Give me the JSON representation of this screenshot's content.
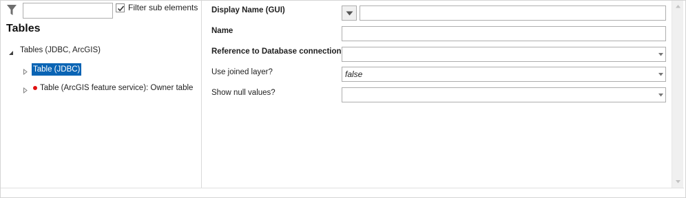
{
  "filter": {
    "input_value": "",
    "checkbox_checked": true,
    "checkbox_label": "Filter sub elements",
    "icon": "filter-funnel-icon"
  },
  "tree": {
    "heading": "Tables",
    "root": {
      "label": "Tables (JDBC, ArcGIS)",
      "expanded": true,
      "children": [
        {
          "label": "Table (JDBC)",
          "selected": true,
          "error": false
        },
        {
          "label": "Table (ArcGIS feature service): Owner table",
          "selected": false,
          "error": true
        }
      ]
    }
  },
  "form": {
    "display_name": {
      "label": "Display Name (GUI)",
      "value": ""
    },
    "name": {
      "label": "Name",
      "value": ""
    },
    "db_connection": {
      "label": "Reference to Database connection",
      "value": ""
    },
    "use_joined_layer": {
      "label": "Use joined layer?",
      "value": "false"
    },
    "show_null_values": {
      "label": "Show null values?",
      "value": ""
    }
  },
  "colors": {
    "selection": "#0a64b4",
    "error_dot": "#e01010",
    "border": "#adadad"
  }
}
